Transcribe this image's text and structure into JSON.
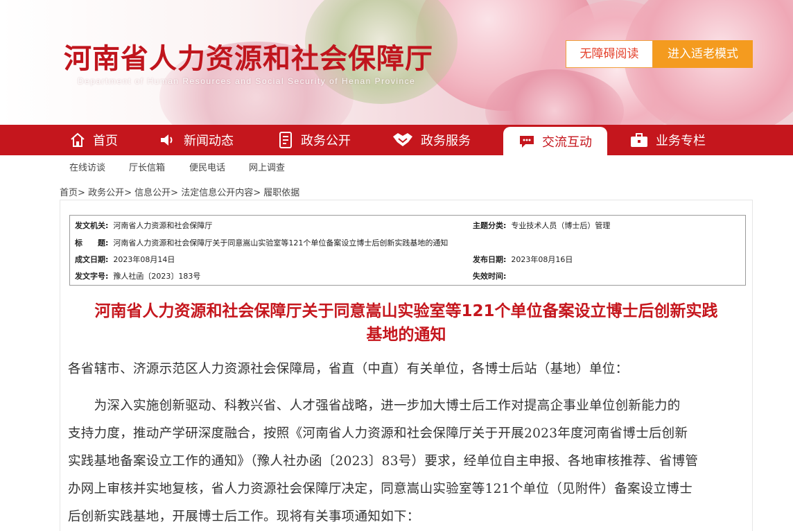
{
  "header": {
    "title": "河南省人力资源和社会保障厅",
    "subtitle": "Department of Human Resources and Social Security of Henan Province",
    "accessibility_button": "无障碍阅读",
    "elder_mode_button": "进入适老模式",
    "colors": {
      "brand_red": "#c5161d",
      "accent_orange": "#f49b1f"
    }
  },
  "nav": {
    "items": [
      {
        "label": "首页",
        "icon": "home-icon"
      },
      {
        "label": "新闻动态",
        "icon": "speaker-icon"
      },
      {
        "label": "政务公开",
        "icon": "document-icon"
      },
      {
        "label": "政务服务",
        "icon": "handshake-icon"
      },
      {
        "label": "交流互动",
        "icon": "chat-icon",
        "active": true
      },
      {
        "label": "业务专栏",
        "icon": "briefcase-icon"
      }
    ],
    "subitems": [
      "在线访谈",
      "厅长信箱",
      "便民电话",
      "网上调查"
    ]
  },
  "breadcrumb": {
    "items": [
      "首页",
      "政务公开",
      "信息公开",
      "法定信息公开内容",
      "履职依据"
    ],
    "separator": ">"
  },
  "meta": {
    "issuer_label": "发文机关:",
    "issuer": "河南省人力资源和社会保障厅",
    "topic_label": "主题分类:",
    "topic": "专业技术人员（博士后）管理",
    "title_label": "标　　题:",
    "title": "河南省人力资源和社会保障厅关于同意嵩山实验室等121个单位备案设立博士后创新实践基地的通知",
    "written_date_label": "成文日期:",
    "written_date": "2023年08月14日",
    "publish_date_label": "发布日期:",
    "publish_date": "2023年08月16日",
    "doc_number_label": "发文字号:",
    "doc_number": "豫人社函〔2023〕183号",
    "expiry_label": "失效时间:",
    "expiry": ""
  },
  "article": {
    "title_line1": "河南省人力资源和社会保障厅关于同意嵩山实验室等121个单位备案设立博士后创新实践",
    "title_line2": "基地的通知",
    "salutation": "各省辖市、济源示范区人力资源社会保障局，省直（中直）有关单位，各博士后站（基地）单位：",
    "paragraph_lines": [
      "　　为深入实施创新驱动、科教兴省、人才强省战略，进一步加大博士后工作对提高企事业单位创新能力的",
      "支持力度，推动产学研深度融合，按照《河南省人力资源和社会保障厅关于开展2023年度河南省博士后创新",
      "实践基地备案设立工作的通知》（豫人社办函〔2023〕83号）要求，经单位自主申报、各地审核推荐、省博管",
      "办网上审核并实地复核，省人力资源社会保障厅决定，同意嵩山实验室等121个单位（见附件）备案设立博士",
      "后创新实践基地，开展博士后工作。现将有关事项通知如下："
    ]
  }
}
